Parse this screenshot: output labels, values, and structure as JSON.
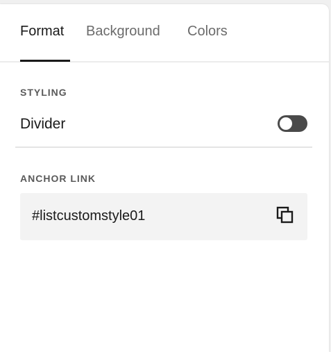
{
  "tabs": [
    {
      "label": "Format",
      "active": true
    },
    {
      "label": "Background",
      "active": false
    },
    {
      "label": "Colors",
      "active": false
    }
  ],
  "styling": {
    "section_label": "STYLING",
    "divider_label": "Divider",
    "divider_enabled": false
  },
  "anchor": {
    "section_label": "ANCHOR LINK",
    "value": "#listcustomstyle01",
    "copy_icon": "copy-icon"
  },
  "colors": {
    "active_tab": "#1a1a1a",
    "inactive_tab": "#6b6b6b",
    "toggle_off": "#4a4a4a",
    "field_bg": "#f3f3f3"
  }
}
